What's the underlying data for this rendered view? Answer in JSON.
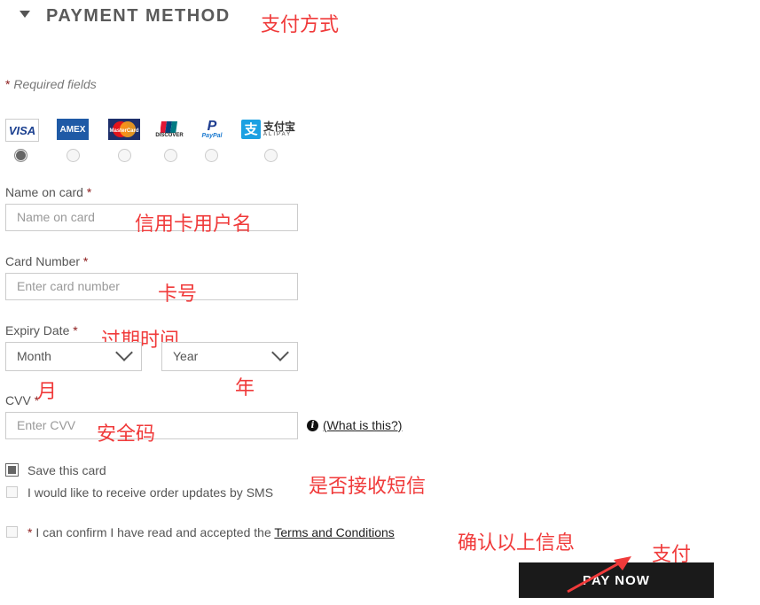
{
  "header": {
    "title": "PAYMENT METHOD",
    "annotation": "支付方式"
  },
  "required_note": {
    "star": "*",
    "text": " Required fields"
  },
  "card_types": [
    {
      "name": "VISA",
      "selected": true
    },
    {
      "name": "AMEX",
      "selected": false
    },
    {
      "name": "MasterCard",
      "selected": false
    },
    {
      "name": "UnionPay / DISCOVER",
      "selected": false
    },
    {
      "name": "PayPal",
      "selected": false
    },
    {
      "name": "支付宝 ALIPAY",
      "selected": false
    }
  ],
  "logos": {
    "visa": "VISA",
    "amex": "AMEX",
    "mastercard": "MasterCard",
    "unionpay": "UnionPay",
    "discover": "DISCOVER",
    "paypal": "PayPal",
    "alipay_cn": "支付宝",
    "alipay_en": "ALIPAY",
    "alipay_glyph": "支"
  },
  "fields": {
    "name_on_card": {
      "label": "Name on card",
      "star": "*",
      "placeholder": "Name on card",
      "annotation": "信用卡用户名"
    },
    "card_number": {
      "label": "Card Number",
      "star": "*",
      "placeholder": "Enter card number",
      "annotation": "卡号"
    },
    "expiry": {
      "label": "Expiry Date",
      "star": "*",
      "annotation": "过期时间",
      "month": "Month",
      "year": "Year",
      "month_annotation": "月",
      "year_annotation": "年"
    },
    "cvv": {
      "label": "CVV",
      "star": "*",
      "placeholder": "Enter CVV",
      "annotation": "安全码",
      "help_link": "(What is this?)"
    }
  },
  "checkboxes": {
    "save_card": {
      "label": "Save this card",
      "checked": true
    },
    "sms": {
      "label": "I would like to receive order updates by SMS",
      "checked": false,
      "annotation": "是否接收短信"
    },
    "terms": {
      "star": "*",
      "text": " I can confirm I have read and accepted the ",
      "link": "Terms and Conditions",
      "checked": false,
      "annotation": "确认以上信息"
    }
  },
  "pay_button": {
    "label": "PAY NOW",
    "annotation": "支付"
  },
  "colors": {
    "annotation": "#f03a3a",
    "button_bg": "#1a1a1a",
    "required_star": "#8b1a1a"
  }
}
